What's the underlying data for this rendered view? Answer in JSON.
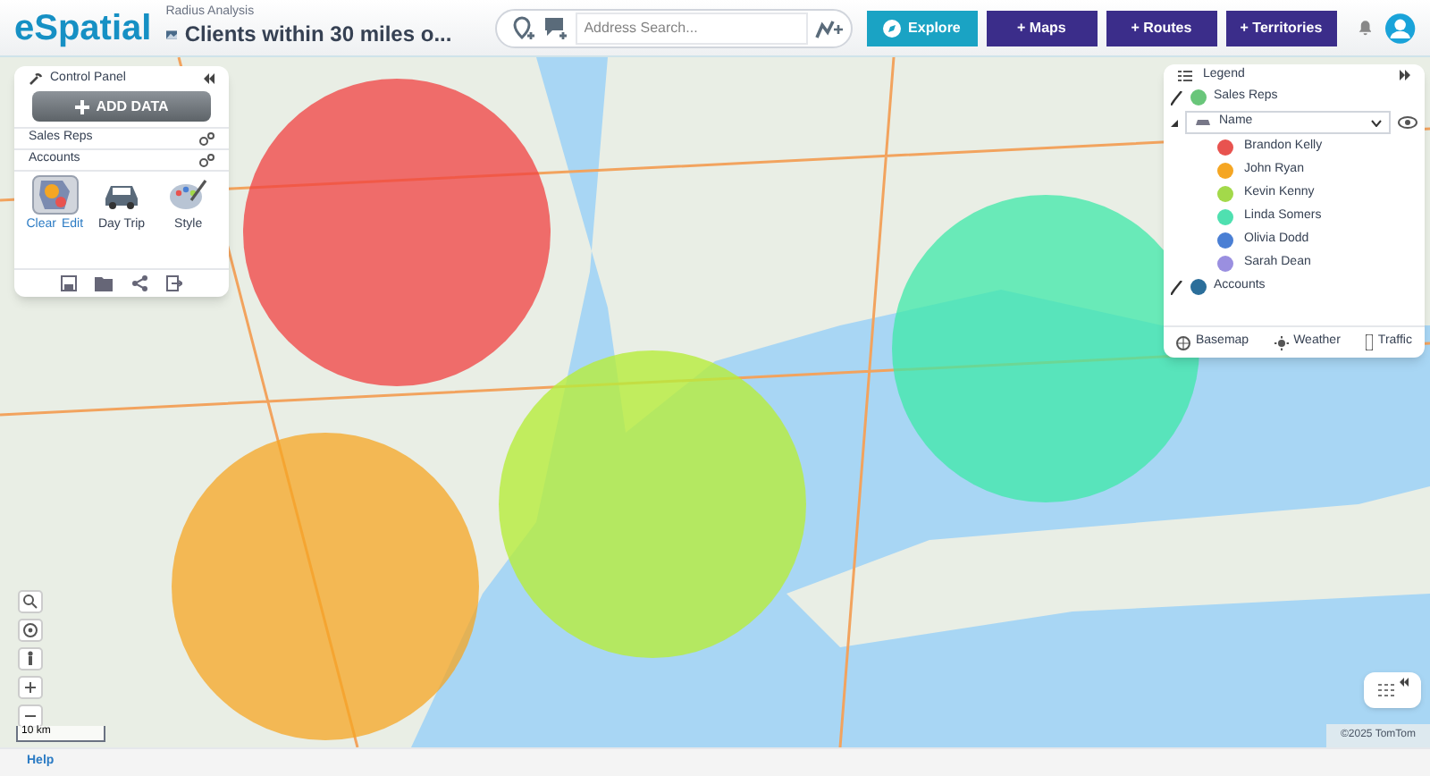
{
  "header": {
    "logo": "eSpatial",
    "subtitle": "Radius Analysis",
    "map_title": "Clients within 30 miles o...",
    "search": {
      "placeholder": "Address Search..."
    },
    "nav_buttons": [
      {
        "label": "Explore",
        "kind": "explore"
      },
      {
        "label": "+ Maps",
        "kind": "plain"
      },
      {
        "label": "+ Routes",
        "kind": "plain"
      },
      {
        "label": "+ Territories",
        "kind": "plain"
      }
    ]
  },
  "control_panel": {
    "title": "Control Panel",
    "add_button": "ADD DATA",
    "layers": [
      "Sales Reps",
      "Accounts"
    ],
    "tools": [
      {
        "kind": "radius",
        "selected": true,
        "actions": [
          "Clear",
          "Edit"
        ]
      },
      {
        "kind": "day_trip",
        "selected": false,
        "label": "Day Trip"
      },
      {
        "kind": "style",
        "selected": false,
        "label": "Style"
      }
    ]
  },
  "legend": {
    "title": "Legend",
    "layer": "Sales Reps",
    "group_by": "Name",
    "items": [
      {
        "name": "Brandon Kelly",
        "color": "#e8534f"
      },
      {
        "name": "John Ryan",
        "color": "#f5a623"
      },
      {
        "name": "Kevin Kenny",
        "color": "#a3d94a"
      },
      {
        "name": "Linda Somers",
        "color": "#4fe0b0"
      },
      {
        "name": "Olivia Dodd",
        "color": "#4a7fd4"
      },
      {
        "name": "Sarah Dean",
        "color": "#9a8fe0"
      }
    ],
    "accounts": "Accounts",
    "footer_buttons": [
      {
        "label": "Basemap",
        "kind": "basemap"
      },
      {
        "label": "Weather",
        "kind": "weather"
      },
      {
        "label": "Traffic",
        "kind": "traffic"
      }
    ]
  },
  "map": {
    "scale": "10 km",
    "copyright": "©2025 TomTom"
  },
  "footer": {
    "help": "Help"
  }
}
